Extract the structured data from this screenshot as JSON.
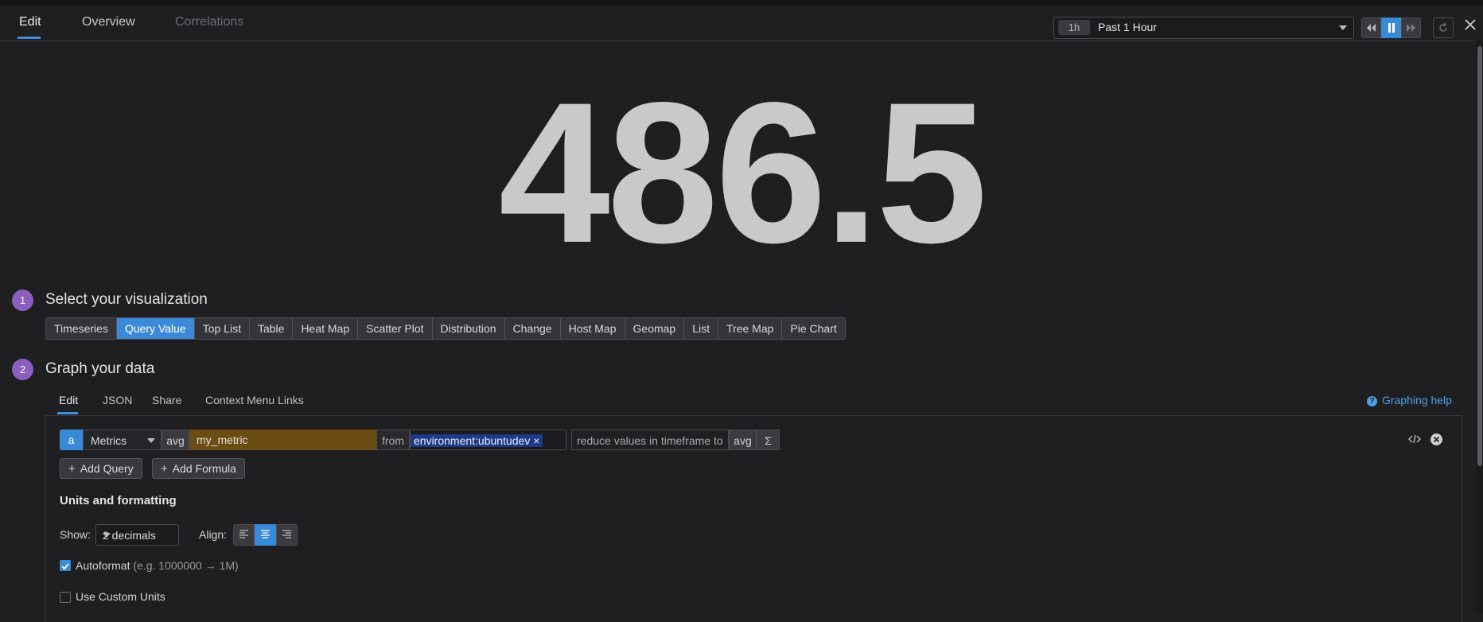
{
  "tabs": [
    {
      "label": "Edit",
      "state": "active"
    },
    {
      "label": "Overview",
      "state": "normal"
    },
    {
      "label": "Correlations",
      "state": "disabled"
    }
  ],
  "timeframe": {
    "badge": "1h",
    "label": "Past 1 Hour"
  },
  "controls": {
    "paused": true
  },
  "value_display": {
    "value": "486.5"
  },
  "steps": [
    {
      "number": "1",
      "title": "Select your visualization"
    },
    {
      "number": "2",
      "title": "Graph your data"
    }
  ],
  "visualizations": {
    "items": [
      "Timeseries",
      "Query Value",
      "Top List",
      "Table",
      "Heat Map",
      "Scatter Plot",
      "Distribution",
      "Change",
      "Host Map",
      "Geomap",
      "List",
      "Tree Map",
      "Pie Chart"
    ],
    "selected": "Query Value"
  },
  "editor_tabs": [
    "Edit",
    "JSON",
    "Share",
    "Context Menu Links"
  ],
  "help_link": "Graphing help",
  "query": {
    "letter": "a",
    "source": "Metrics",
    "aggregator": "avg",
    "metric": "my_metric",
    "from_label": "from",
    "tag": "environment:ubuntudev",
    "tag_remove": "×",
    "reduce_label": "reduce values in timeframe to",
    "reduce_value": "avg",
    "sigma": "Σ"
  },
  "buttons": {
    "add_query": "Add Query",
    "add_formula": "Add Formula"
  },
  "units": {
    "title": "Units and formatting",
    "show_label": "Show:",
    "decimals": "2 decimals",
    "align_label": "Align:",
    "align_selected": "center",
    "autoformat_label": "Autoformat",
    "autoformat_hint": "(e.g. 1000000 → 1M)",
    "autoformat_checked": true,
    "custom_units_label": "Use Custom Units",
    "custom_units_checked": false
  },
  "colors": {
    "accent": "#3b8ad8",
    "step_badge": "#8a5fbf",
    "metric_bg": "#6b4c14",
    "tag_bg": "#1f3a85",
    "value": "#c9c9cb"
  }
}
